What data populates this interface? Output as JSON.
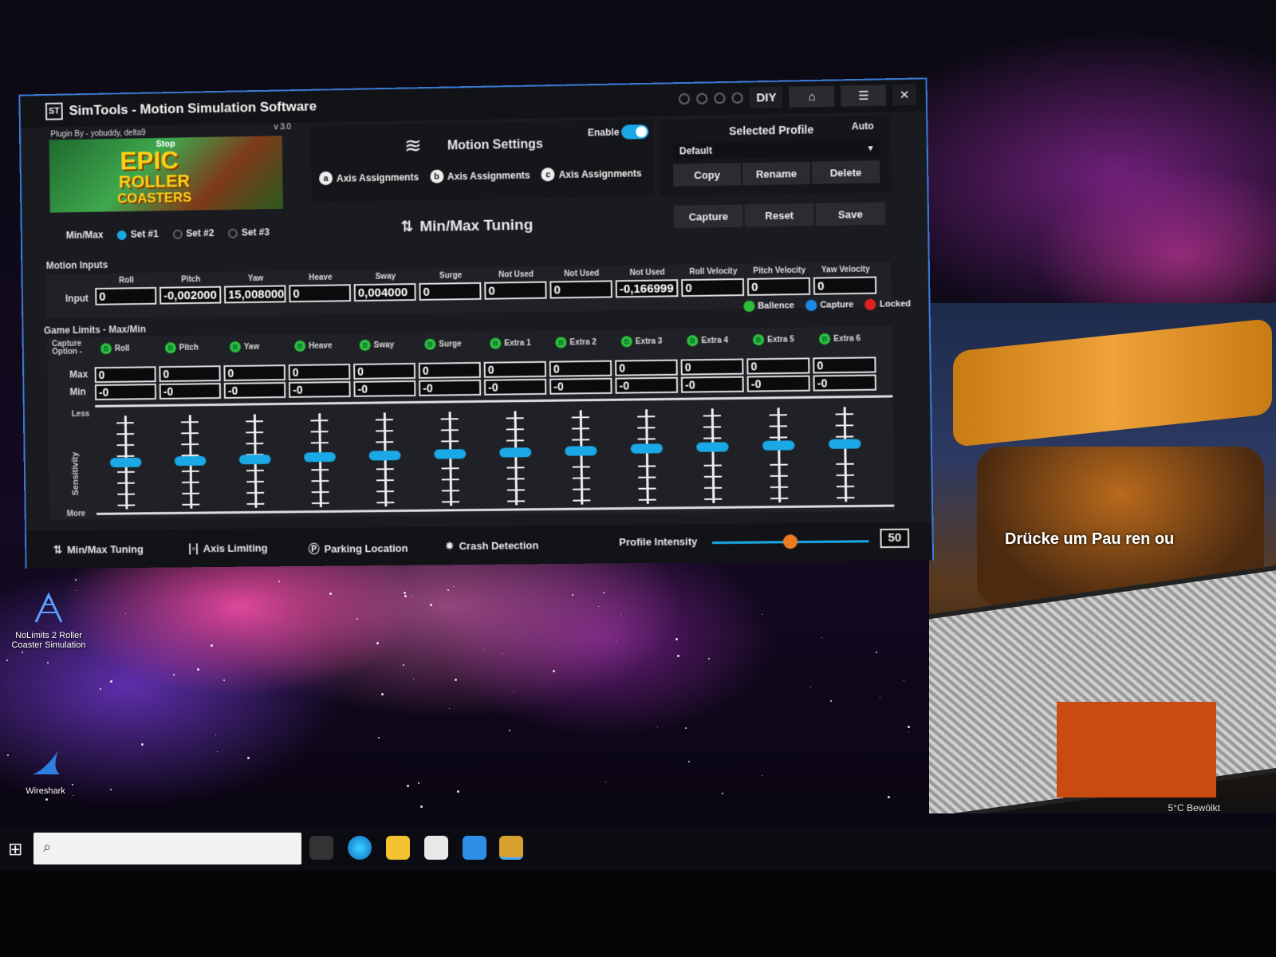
{
  "window": {
    "title": "SimTools - Motion Simulation Software",
    "logo_text": "ST",
    "diy_label": "DIY",
    "home_icon": "home-icon",
    "menu_icon": "menu-icon",
    "close_label": "✕"
  },
  "plugin": {
    "credit": "Plugin By - yobuddy, delta9",
    "version": "v 3.0",
    "banner_stop": "Stop",
    "banner_line1": "EPIC",
    "banner_line2": "ROLLER",
    "banner_line3": "COASTERS"
  },
  "motion_settings": {
    "title": "Motion Settings",
    "enable_label": "Enable",
    "enabled": true,
    "axis_buttons": [
      {
        "letter": "a",
        "label": "Axis Assignments"
      },
      {
        "letter": "b",
        "label": "Axis Assignments"
      },
      {
        "letter": "c",
        "label": "Axis Assignments"
      }
    ]
  },
  "profile": {
    "title": "Selected Profile",
    "auto_label": "Auto",
    "selected": "Default",
    "buttons": [
      "Copy",
      "Rename",
      "Delete"
    ],
    "capture_buttons": [
      "Capture",
      "Reset",
      "Save"
    ]
  },
  "minmax": {
    "label": "Min/Max",
    "sets": [
      "Set #1",
      "Set #2",
      "Set #3"
    ],
    "active_set": 0,
    "title": "Min/Max Tuning"
  },
  "motion_inputs": {
    "section": "Motion Inputs",
    "row_label": "Input",
    "columns": [
      "Roll",
      "Pitch",
      "Yaw",
      "Heave",
      "Sway",
      "Surge",
      "Not Used",
      "Not Used",
      "Not Used",
      "Roll Velocity",
      "Pitch Velocity",
      "Yaw Velocity"
    ],
    "values": [
      "0",
      "-0,002000",
      "15,008000",
      "0",
      "0,004000",
      "0",
      "0",
      "0",
      "-0,166999",
      "0",
      "0",
      "0"
    ]
  },
  "legend": [
    {
      "letter": "B",
      "label": "Ballence",
      "color": "#2dbf3c"
    },
    {
      "letter": "C",
      "label": "Capture",
      "color": "#1a8ae6"
    },
    {
      "letter": "L",
      "label": "Locked",
      "color": "#e02020"
    }
  ],
  "game_limits": {
    "section": "Game Limits - Max/Min",
    "capture_option": "Capture Option -",
    "columns": [
      "Roll",
      "Pitch",
      "Yaw",
      "Heave",
      "Sway",
      "Surge",
      "Extra 1",
      "Extra 2",
      "Extra 3",
      "Extra 4",
      "Extra 5",
      "Extra 6"
    ],
    "max_label": "Max",
    "min_label": "Min",
    "max_values": [
      "0",
      "0",
      "0",
      "0",
      "0",
      "0",
      "0",
      "0",
      "0",
      "0",
      "0",
      "0"
    ],
    "min_values": [
      "-0",
      "-0",
      "-0",
      "-0",
      "-0",
      "-0",
      "-0",
      "-0",
      "-0",
      "-0",
      "-0",
      "-0"
    ],
    "less_label": "Less",
    "more_label": "More",
    "sensitivity_label": "Sensitivity",
    "sensitivity_levels": [
      0.5,
      0.5,
      0.5,
      0.5,
      0.5,
      0.5,
      0.5,
      0.5,
      0.5,
      0.5,
      0.5,
      0.5
    ]
  },
  "bottom_nav": {
    "items": [
      {
        "label": "Min/Max Tuning",
        "icon": "arrows-updown-icon"
      },
      {
        "label": "Axis Limiting",
        "icon": "axis-limit-icon"
      },
      {
        "label": "Parking Location",
        "icon": "parking-icon"
      },
      {
        "label": "Crash Detection",
        "icon": "crash-icon"
      }
    ],
    "intensity_label": "Profile Intensity",
    "intensity_value": "50",
    "intensity_fraction": 0.5
  },
  "desktop": {
    "icons": [
      {
        "label": "NoLimits 2 Roller Coaster Simulation"
      },
      {
        "label": "Wireshark"
      }
    ],
    "game_overlay_text": "Drücke   um Pau  ren ou",
    "weather": "5°C Bewölkt"
  },
  "colors": {
    "accent": "#1aa8e6",
    "window_border": "#3b7bd6",
    "intensity_knob": "#f07a22",
    "green": "#2dbf3c"
  }
}
